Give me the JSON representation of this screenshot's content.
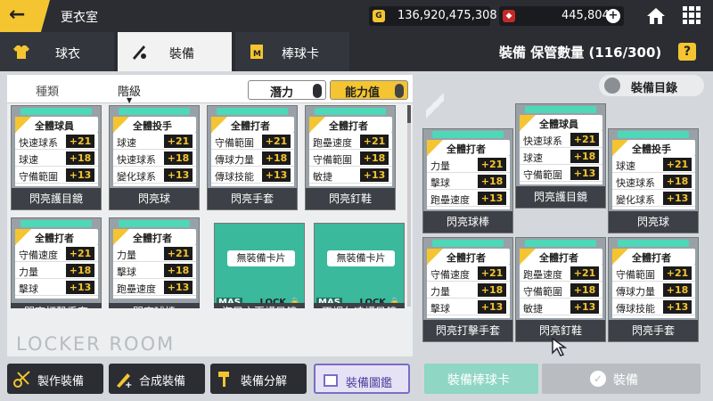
{
  "header": {
    "title": "更衣室",
    "back_icon": "back-arrow-icon"
  },
  "currency": {
    "coins": "136,920,475,308",
    "gems": "445,804"
  },
  "tabs": [
    {
      "label": "球衣",
      "icon": "jersey-icon"
    },
    {
      "label": "裝備",
      "icon": "bat-ball-icon"
    },
    {
      "label": "棒球卡",
      "icon": "card-icon"
    }
  ],
  "storage": {
    "label": "裝備 保管數量 (116/300)",
    "help": "?"
  },
  "filters": {
    "type": "種類",
    "grade": "階級",
    "potential": "潛力",
    "ability": "能力值"
  },
  "inventory": [
    {
      "header": "全體球員",
      "stats": [
        [
          "快速球系",
          "+21"
        ],
        [
          "球速",
          "+18"
        ],
        [
          "守備範圍",
          "+13"
        ]
      ],
      "name": "閃亮護目鏡"
    },
    {
      "header": "全體投手",
      "stats": [
        [
          "球速",
          "+21"
        ],
        [
          "快速球系",
          "+18"
        ],
        [
          "變化球系",
          "+13"
        ]
      ],
      "name": "閃亮球"
    },
    {
      "header": "全體打者",
      "stats": [
        [
          "守備範圍",
          "+21"
        ],
        [
          "傳球力量",
          "+18"
        ],
        [
          "傳球技能",
          "+13"
        ]
      ],
      "name": "閃亮手套"
    },
    {
      "header": "全體打者",
      "stats": [
        [
          "跑壘速度",
          "+21"
        ],
        [
          "守備範圍",
          "+18"
        ],
        [
          "敏捷",
          "+13"
        ]
      ],
      "name": "閃亮釘鞋"
    },
    {
      "header": "全體打者",
      "stats": [
        [
          "守備速度",
          "+21"
        ],
        [
          "力量",
          "+18"
        ],
        [
          "擊球",
          "+13"
        ]
      ],
      "name": "閃亮打擊手套"
    },
    {
      "header": "全體打者",
      "stats": [
        [
          "力量",
          "+21"
        ],
        [
          "擊球",
          "+18"
        ],
        [
          "跑壘速度",
          "+13"
        ]
      ],
      "name": "閃亮球棒"
    }
  ],
  "empty_cards": [
    {
      "label": "無裝備卡片",
      "mas": "MAS",
      "lock": "LOCK",
      "name": "海風之夏護目鏡"
    },
    {
      "label": "無裝備卡片",
      "mas": "MAS",
      "lock": "LOCK",
      "name": "不調久遠護目鏡"
    }
  ],
  "logo": "LOCKER ROOM",
  "bottom_buttons": [
    "製作裝備",
    "合成裝備",
    "裝備分解",
    "裝備圖鑑"
  ],
  "equipped": [
    {
      "header": "全體打者",
      "stats": [
        [
          "力量",
          "+21"
        ],
        [
          "擊球",
          "+18"
        ],
        [
          "跑壘速度",
          "+13"
        ]
      ],
      "name": "閃亮球棒"
    },
    {
      "header": "全體球員",
      "stats": [
        [
          "快速球系",
          "+21"
        ],
        [
          "球速",
          "+18"
        ],
        [
          "守備範圍",
          "+13"
        ]
      ],
      "name": "閃亮護目鏡"
    },
    {
      "header": "全體投手",
      "stats": [
        [
          "球速",
          "+21"
        ],
        [
          "快速球系",
          "+18"
        ],
        [
          "變化球系",
          "+13"
        ]
      ],
      "name": "閃亮球"
    },
    {
      "header": "全體打者",
      "stats": [
        [
          "守備速度",
          "+21"
        ],
        [
          "力量",
          "+18"
        ],
        [
          "擊球",
          "+13"
        ]
      ],
      "name": "閃亮打擊手套"
    },
    {
      "header": "全體打者",
      "stats": [
        [
          "跑壘速度",
          "+21"
        ],
        [
          "守備範圍",
          "+18"
        ],
        [
          "敏捷",
          "+13"
        ]
      ],
      "name": "閃亮釘鞋"
    },
    {
      "header": "全體打者",
      "stats": [
        [
          "守備範圍",
          "+21"
        ],
        [
          "傳球力量",
          "+18"
        ],
        [
          "傳球技能",
          "+13"
        ]
      ],
      "name": "閃亮手套"
    }
  ],
  "directory_button": "裝備目錄",
  "action_buttons": {
    "equip_card": "裝備棒球卡",
    "equip": "裝備"
  },
  "colors": {
    "accent": "#f4c531",
    "dark": "#2b2d33",
    "teal": "#3ab99c"
  }
}
